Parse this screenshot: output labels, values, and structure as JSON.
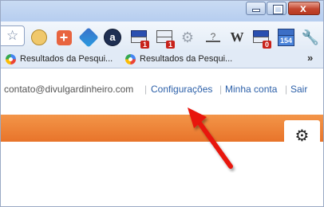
{
  "browser": {
    "window_controls": {
      "minimize_glyph": "_",
      "maximize_glyph": "□",
      "close_glyph": "x"
    },
    "toolbar": {
      "star_icon": "star-icon",
      "extensions": [
        {
          "name": "smiley-extension-icon"
        },
        {
          "name": "plus-extension-icon",
          "glyph": "+"
        },
        {
          "name": "puzzle-extension-icon"
        },
        {
          "name": "a-extension-icon",
          "glyph": "a"
        },
        {
          "name": "mail-extension-icon",
          "badge": "1"
        },
        {
          "name": "mail-extension-icon",
          "badge": "1"
        },
        {
          "name": "gear-extension-icon"
        },
        {
          "name": "question-extension-icon",
          "glyph": "?"
        },
        {
          "name": "w-extension-icon",
          "glyph": "W"
        },
        {
          "name": "mail-extension-icon",
          "badge": "0"
        },
        {
          "name": "calendar-extension-icon",
          "badge": "154"
        },
        {
          "name": "wrench-icon"
        }
      ]
    },
    "bookmarks": [
      {
        "label": "Resultados da Pesqui..."
      },
      {
        "label": "Resultados da Pesqui..."
      }
    ],
    "bookmarks_overflow": "»"
  },
  "page": {
    "user_email": "contato@divulgardinheiro.com",
    "separator": "|",
    "links": {
      "settings": "Configurações",
      "account": "Minha conta",
      "logout": "Sair"
    },
    "gear_icon": "settings-gear-icon",
    "colors": {
      "orange_bar": "#ef8539",
      "link": "#2b5fa8",
      "arrow": "#e8120c"
    }
  }
}
